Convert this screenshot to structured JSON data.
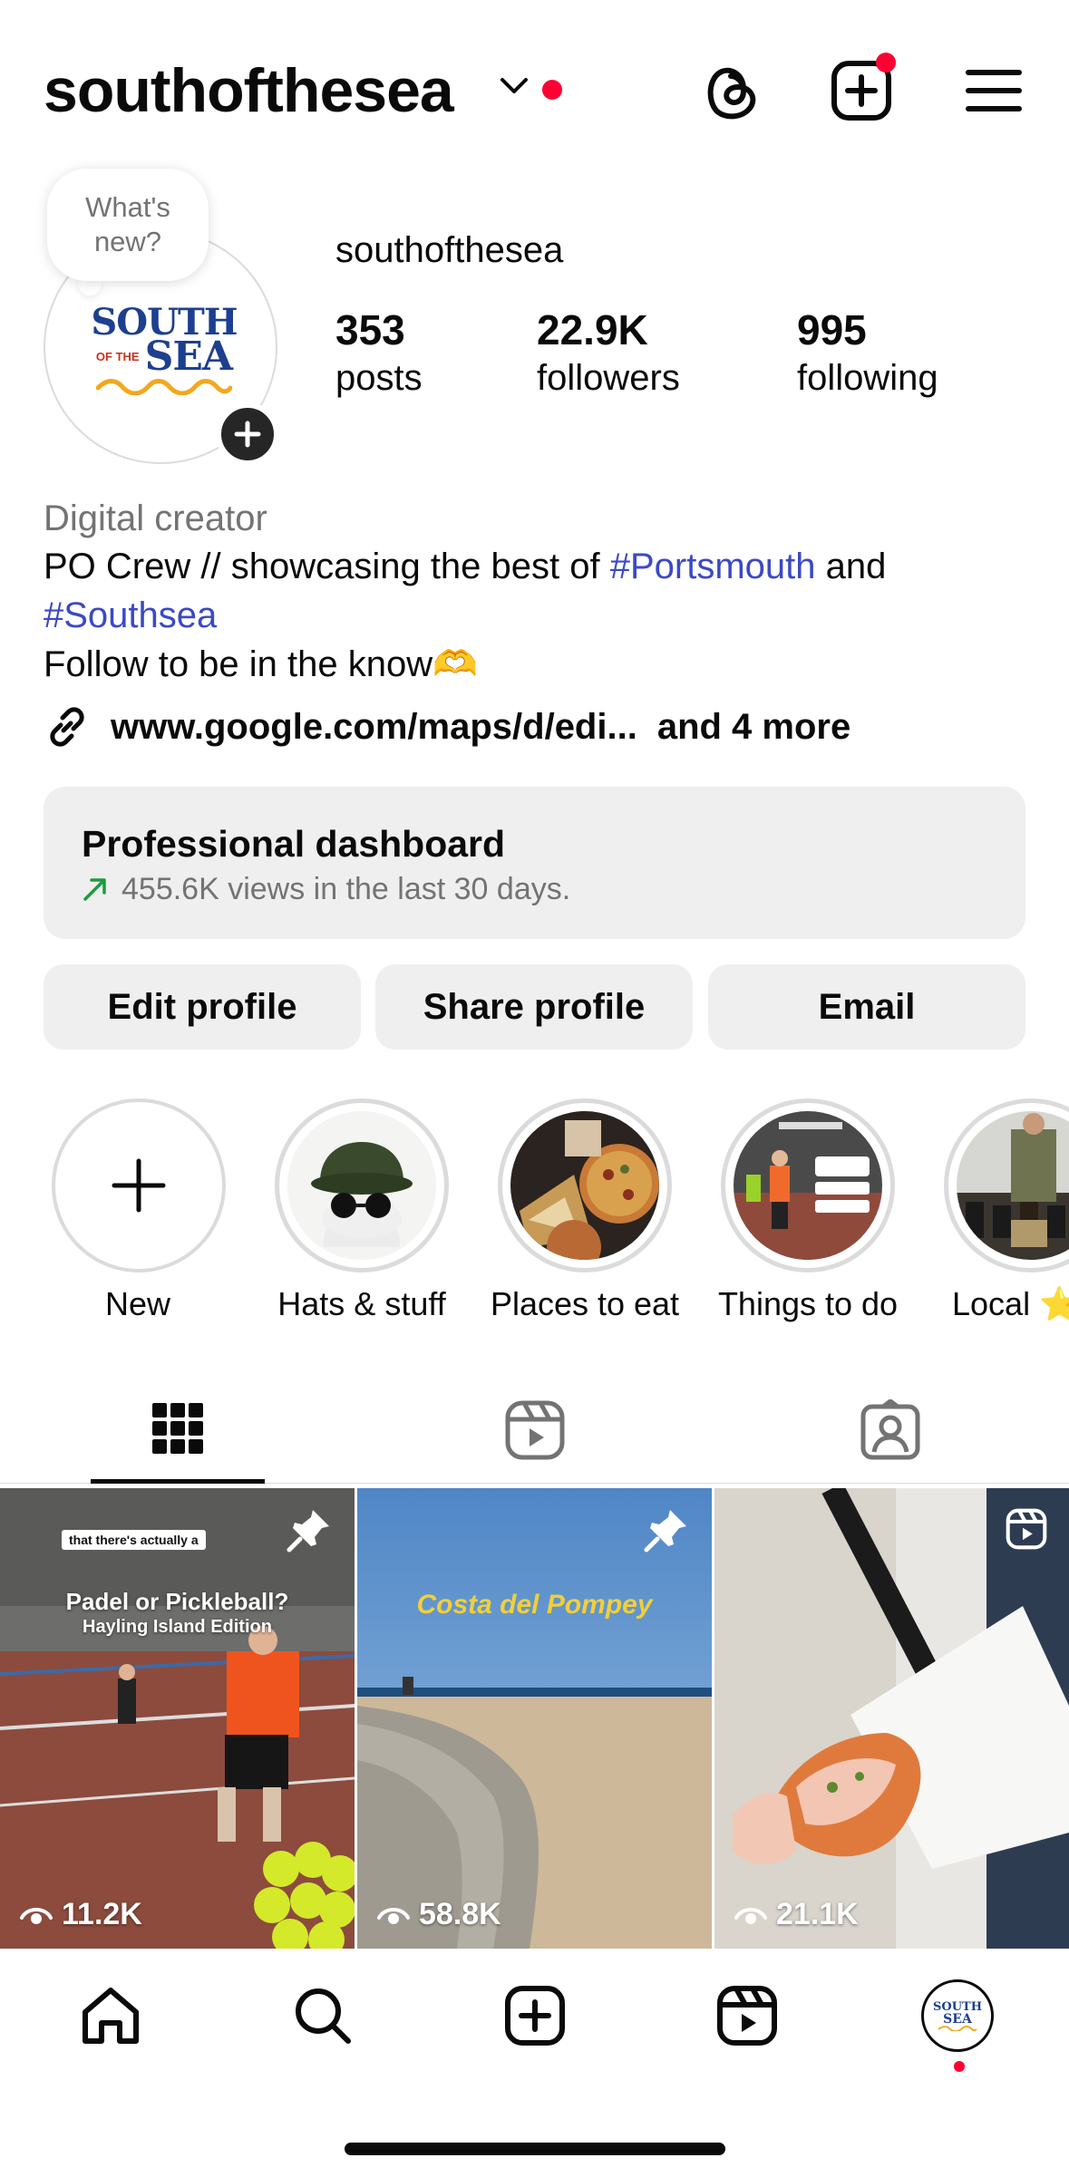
{
  "header": {
    "username": "southofthesea",
    "icons": [
      "chevron-down-icon",
      "threads-icon",
      "create-icon",
      "menu-icon"
    ]
  },
  "profile": {
    "note_bubble": "What's new?",
    "logo": {
      "line1": "SOUTH",
      "small": "OF THE",
      "line2": "SEA"
    },
    "name": "southofthesea",
    "stats": [
      {
        "value": "353",
        "label": "posts"
      },
      {
        "value": "22.9K",
        "label": "followers"
      },
      {
        "value": "995",
        "label": "following"
      }
    ],
    "category": "Digital creator",
    "bio": {
      "line1_prefix": "PO Crew // showcasing the best of ",
      "hashtag1": "#Portsmouth",
      "line1_suffix": " and",
      "hashtag2": "#Southsea",
      "line3": "Follow to be in the know🫶"
    },
    "link": {
      "text": "www.google.com/maps/d/edi...",
      "more": "and 4 more"
    }
  },
  "dashboard": {
    "title": "Professional dashboard",
    "subtitle": "455.6K views in the last 30 days.",
    "trend_color": "#1a9c3e"
  },
  "buttons": [
    "Edit profile",
    "Share profile",
    "Email"
  ],
  "highlights": [
    {
      "label": "New"
    },
    {
      "label": "Hats & stuff"
    },
    {
      "label": "Places to eat"
    },
    {
      "label": "Things to do"
    },
    {
      "label": "Local ⭐"
    }
  ],
  "posts": [
    {
      "views": "11.2K",
      "pinned": true,
      "overlay_small": "that there's actually a",
      "overlay_title": "Padel or Pickleball?",
      "overlay_sub": "Hayling Island Edition"
    },
    {
      "views": "58.8K",
      "pinned": true,
      "overlay_title": "Costa del Pompey"
    },
    {
      "views": "21.1K",
      "reel": true
    }
  ],
  "colors": {
    "accent_red": "#ff0033",
    "hashtag": "#3b49c6"
  }
}
